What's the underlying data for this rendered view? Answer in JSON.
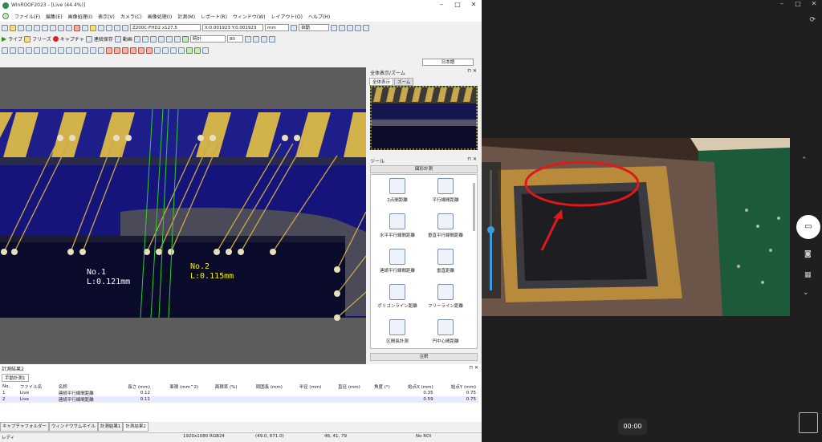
{
  "app": {
    "title": "WinROOF2023 - [Live (44.4%)]"
  },
  "menu": [
    "ファイル(F)",
    "編集(E)",
    "画像処理(I)",
    "表示(V)",
    "カメラ(C)",
    "画像処理(I)",
    "計測(M)",
    "レポート(R)",
    "ウィンドウ(W)",
    "レイアウト(O)",
    "ヘルプ(H)"
  ],
  "toolbar1": {
    "camera": "Z200C-FHD2 x127.5",
    "coords": "X:0.001923 Y:0.001923",
    "unit": "mm",
    "mode": "自動"
  },
  "toolbar2": {
    "live": "ライブ",
    "freeze": "フリーズ",
    "capture": "キャプチャ",
    "continuous": "連続保存",
    "movie": "動画",
    "time_label": "時計",
    "value": "80"
  },
  "toolbar4": {
    "lang": "日本語"
  },
  "viewport": {
    "m1_no": "No.1",
    "m1_len": "L:0.121mm",
    "m2_no": "No.2",
    "m2_len": "L:0.115mm"
  },
  "overview": {
    "title": "全体表示/ズーム",
    "tab1": "全体表示",
    "tab2": "ズーム"
  },
  "tools": {
    "title": "ツール",
    "group": "図形計測",
    "items": [
      "2点間距離",
      "平行線間距離",
      "水平平行線間距離",
      "垂直平行線間距離",
      "連続平行線間距離",
      "垂直距離",
      "ポリゴンライン距離",
      "フリーライン距離",
      "区間長計測",
      "円中心間距離"
    ],
    "footer": "注釈"
  },
  "results": {
    "title": "計測結果2",
    "tab": "手動計測1",
    "columns": [
      "No.",
      "ファイル名",
      "名称",
      "長さ (mm)",
      "面積 (mm^2)",
      "面積率 (%)",
      "周囲長 (mm)",
      "半径 (mm)",
      "直径 (mm)",
      "角度 (°)",
      "始点X (mm)",
      "始点Y (mm)"
    ],
    "rows": [
      [
        "1",
        "Live",
        "連続平行線間距離",
        "0.12",
        "",
        "",
        "",
        "",
        "",
        "",
        "0.35",
        "0.75"
      ],
      [
        "2",
        "Live",
        "連続平行線間距離",
        "0.11",
        "",
        "",
        "",
        "",
        "",
        "",
        "0.59",
        "0.75"
      ]
    ],
    "bottom_tabs": [
      "キャプチャフォルダー",
      "ウィンドウサムネイル",
      "計測結果1",
      "計測結果2"
    ]
  },
  "status": {
    "left": "レディ",
    "res": "1920x1080 RGB24",
    "pos": "(49.0, 671.0)",
    "rgb": "46, 41, 79",
    "roi": "No ROI"
  },
  "camera": {
    "timer": "00:00",
    "logo": "GAKU"
  }
}
